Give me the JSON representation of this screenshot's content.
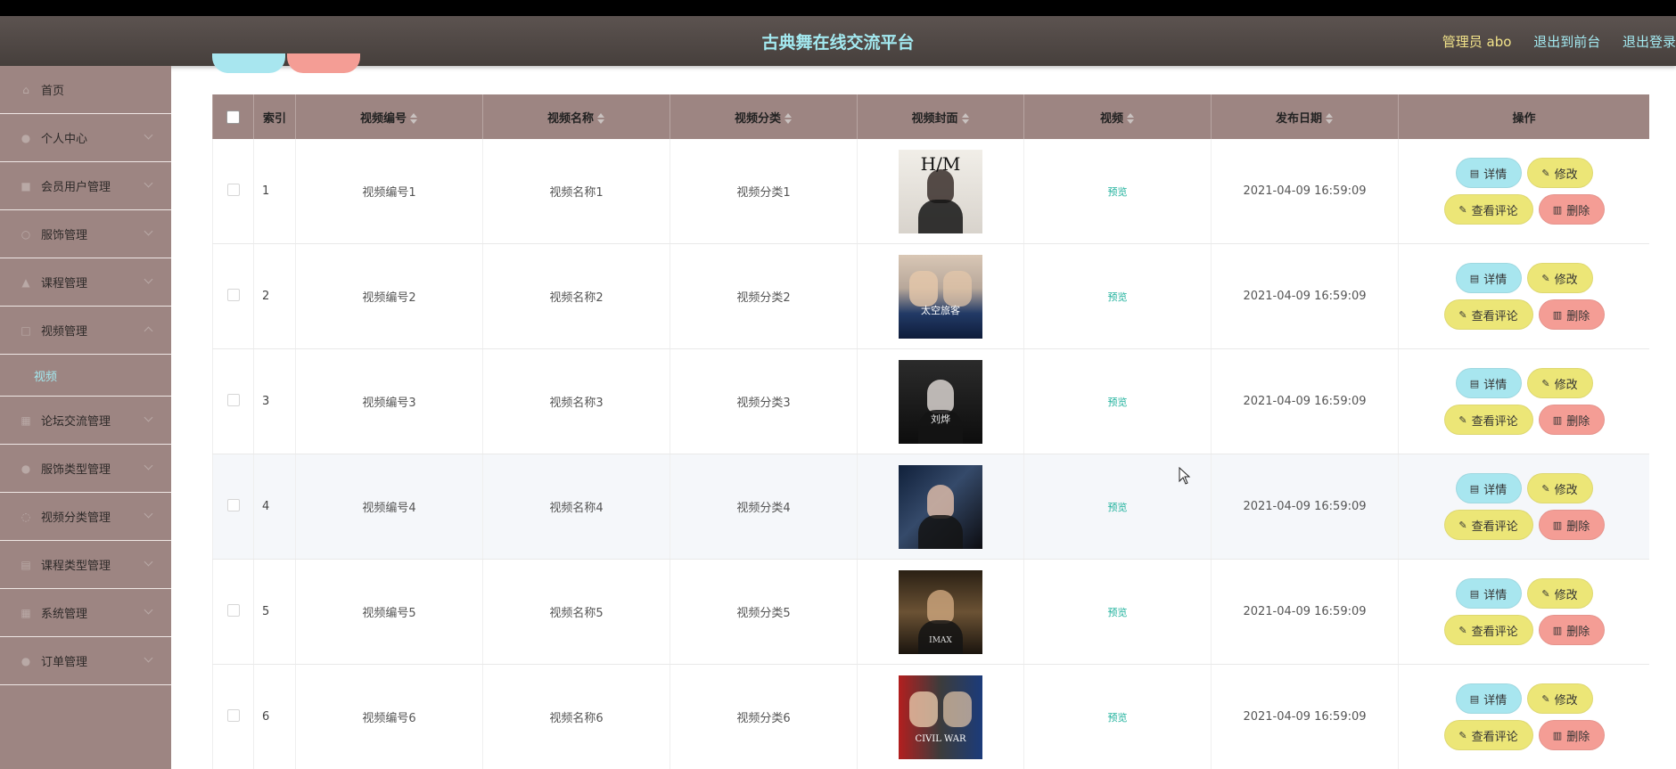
{
  "header": {
    "title": "古典舞在线交流平台",
    "admin": "管理员 abo",
    "to_front": "退出到前台",
    "logout": "退出登录"
  },
  "sidebar": {
    "items": [
      {
        "label": "首页",
        "icon": "home-icon"
      },
      {
        "label": "个人中心",
        "icon": "user-icon"
      },
      {
        "label": "会员用户管理",
        "icon": "users-icon"
      },
      {
        "label": "服饰管理",
        "icon": "shirt-icon"
      },
      {
        "label": "课程管理",
        "icon": "book-icon"
      },
      {
        "label": "视频管理",
        "icon": "video-icon"
      },
      {
        "label": "论坛交流管理",
        "icon": "forum-icon"
      },
      {
        "label": "服饰类型管理",
        "icon": "tag-icon"
      },
      {
        "label": "视频分类管理",
        "icon": "category-icon"
      },
      {
        "label": "课程类型管理",
        "icon": "list-icon"
      },
      {
        "label": "系统管理",
        "icon": "gear-icon"
      },
      {
        "label": "订单管理",
        "icon": "order-icon"
      }
    ],
    "sub_video": "视频"
  },
  "table": {
    "headers": {
      "index": "索引",
      "code": "视频编号",
      "name": "视频名称",
      "category": "视频分类",
      "cover": "视频封面",
      "video": "视频",
      "date": "发布日期",
      "ops": "操作"
    },
    "rows": [
      {
        "index": "1",
        "code": "视频编号1",
        "name": "视频名称1",
        "category": "视频分类1",
        "video": "预览",
        "date": "2021-04-09 16:59:09",
        "poster_text": "H/M"
      },
      {
        "index": "2",
        "code": "视频编号2",
        "name": "视频名称2",
        "category": "视频分类2",
        "video": "预览",
        "date": "2021-04-09 16:59:09",
        "poster_text": "太空旅客"
      },
      {
        "index": "3",
        "code": "视频编号3",
        "name": "视频名称3",
        "category": "视频分类3",
        "video": "预览",
        "date": "2021-04-09 16:59:09",
        "poster_text": "刘烨"
      },
      {
        "index": "4",
        "code": "视频编号4",
        "name": "视频名称4",
        "category": "视频分类4",
        "video": "预览",
        "date": "2021-04-09 16:59:09",
        "poster_text": ""
      },
      {
        "index": "5",
        "code": "视频编号5",
        "name": "视频名称5",
        "category": "视频分类5",
        "video": "预览",
        "date": "2021-04-09 16:59:09",
        "poster_text": "IMAX"
      },
      {
        "index": "6",
        "code": "视频编号6",
        "name": "视频名称6",
        "category": "视频分类6",
        "video": "预览",
        "date": "2021-04-09 16:59:09",
        "poster_text": "CIVIL WAR"
      }
    ],
    "buttons": {
      "detail": "详情",
      "edit": "修改",
      "comment": "查看评论",
      "delete": "删除"
    }
  },
  "colors": {
    "accent_cyan": "#a3e9f0",
    "sidebar_bg": "#9d8582",
    "btn_detail": "#a8e6ef",
    "btn_edit": "#ece677",
    "btn_delete": "#f49d95",
    "preview_link": "#1fb19c"
  }
}
